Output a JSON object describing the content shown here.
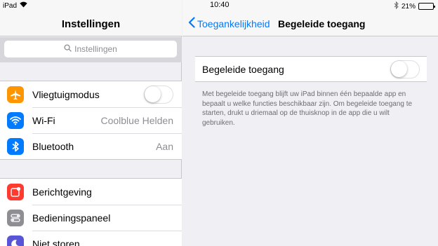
{
  "status_bar": {
    "device": "iPad",
    "time": "10:40",
    "battery_percent": "21%",
    "battery_level": 0.21
  },
  "master": {
    "title": "Instellingen",
    "search_placeholder": "Instellingen",
    "group1": [
      {
        "label": "Vliegtuigmodus",
        "icon": "airplane-icon",
        "color": "#ff9500",
        "toggle": false
      },
      {
        "label": "Wi-Fi",
        "icon": "wifi-icon",
        "color": "#007aff",
        "value": "Coolblue Helden"
      },
      {
        "label": "Bluetooth",
        "icon": "bluetooth-icon",
        "color": "#007aff",
        "value": "Aan"
      }
    ],
    "group2": [
      {
        "label": "Berichtgeving",
        "icon": "notifications-icon",
        "color": "#ff3b30"
      },
      {
        "label": "Bedieningspaneel",
        "icon": "control-center-icon",
        "color": "#8e8e93"
      },
      {
        "label": "Niet storen",
        "icon": "moon-icon",
        "color": "#5856d6"
      }
    ]
  },
  "detail": {
    "back_label": "Toegankelijkheid",
    "title": "Begeleide toegang",
    "setting_label": "Begeleide toegang",
    "setting_on": false,
    "footer": "Met begeleide toegang blijft uw iPad binnen één bepaalde app en bepaalt u welke functies beschikbaar zijn. Om begeleide toegang te starten, drukt u driemaal op de thuisknop in de app die u wilt gebruiken."
  }
}
